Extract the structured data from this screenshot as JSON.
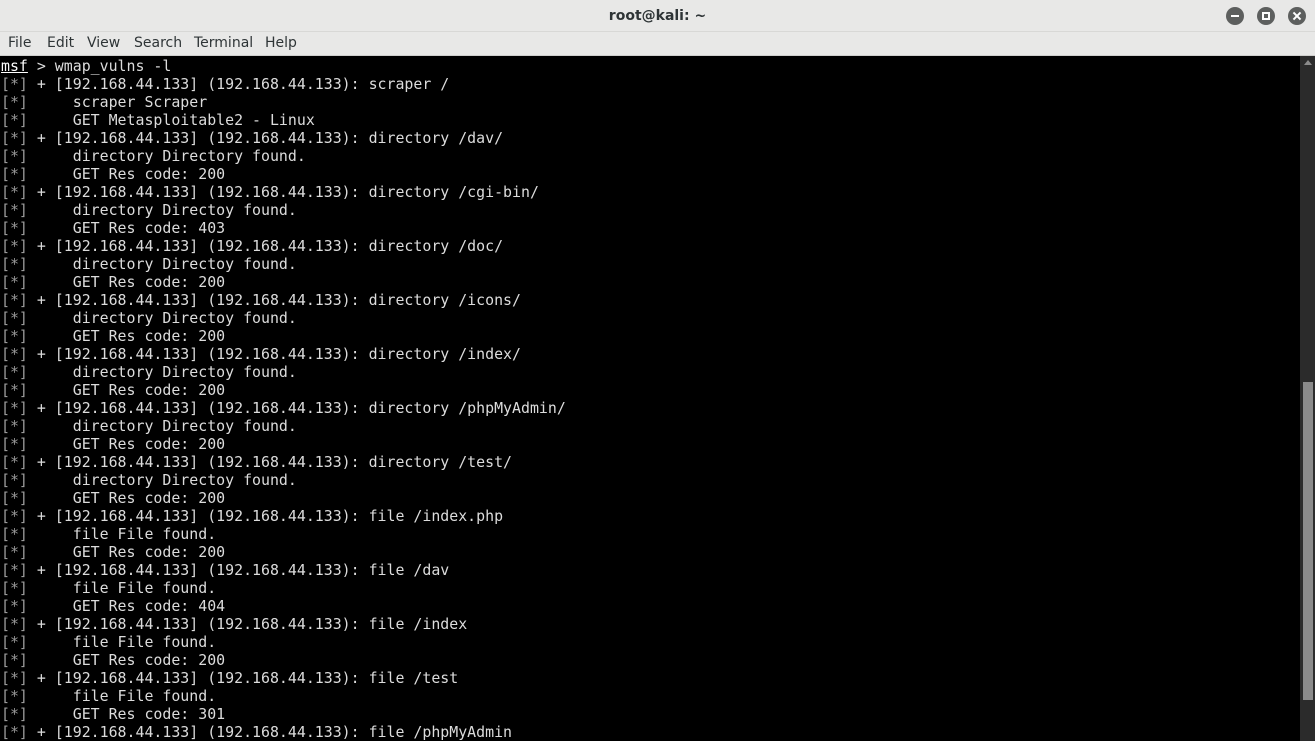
{
  "window": {
    "title": "root@kali: ~"
  },
  "menu": {
    "items": [
      "File",
      "Edit",
      "View",
      "Search",
      "Terminal",
      "Help"
    ]
  },
  "terminal": {
    "prompt": "msf",
    "command": " > wmap_vulns -l",
    "tag": "[*]",
    "lines": [
      " + [192.168.44.133] (192.168.44.133): scraper /",
      "     scraper Scraper",
      "     GET Metasploitable2 - Linux",
      " + [192.168.44.133] (192.168.44.133): directory /dav/",
      "     directory Directory found.",
      "     GET Res code: 200",
      " + [192.168.44.133] (192.168.44.133): directory /cgi-bin/",
      "     directory Directoy found.",
      "     GET Res code: 403",
      " + [192.168.44.133] (192.168.44.133): directory /doc/",
      "     directory Directoy found.",
      "     GET Res code: 200",
      " + [192.168.44.133] (192.168.44.133): directory /icons/",
      "     directory Directoy found.",
      "     GET Res code: 200",
      " + [192.168.44.133] (192.168.44.133): directory /index/",
      "     directory Directoy found.",
      "     GET Res code: 200",
      " + [192.168.44.133] (192.168.44.133): directory /phpMyAdmin/",
      "     directory Directoy found.",
      "     GET Res code: 200",
      " + [192.168.44.133] (192.168.44.133): directory /test/",
      "     directory Directoy found.",
      "     GET Res code: 200",
      " + [192.168.44.133] (192.168.44.133): file /index.php",
      "     file File found.",
      "     GET Res code: 200",
      " + [192.168.44.133] (192.168.44.133): file /dav",
      "     file File found.",
      "     GET Res code: 404",
      " + [192.168.44.133] (192.168.44.133): file /index",
      "     file File found.",
      "     GET Res code: 200",
      " + [192.168.44.133] (192.168.44.133): file /test",
      "     file File found.",
      "     GET Res code: 301",
      " + [192.168.44.133] (192.168.44.133): file /phpMyAdmin"
    ]
  },
  "icons": {
    "minimize": "minimize-icon",
    "maximize": "maximize-icon",
    "close": "close-icon"
  }
}
